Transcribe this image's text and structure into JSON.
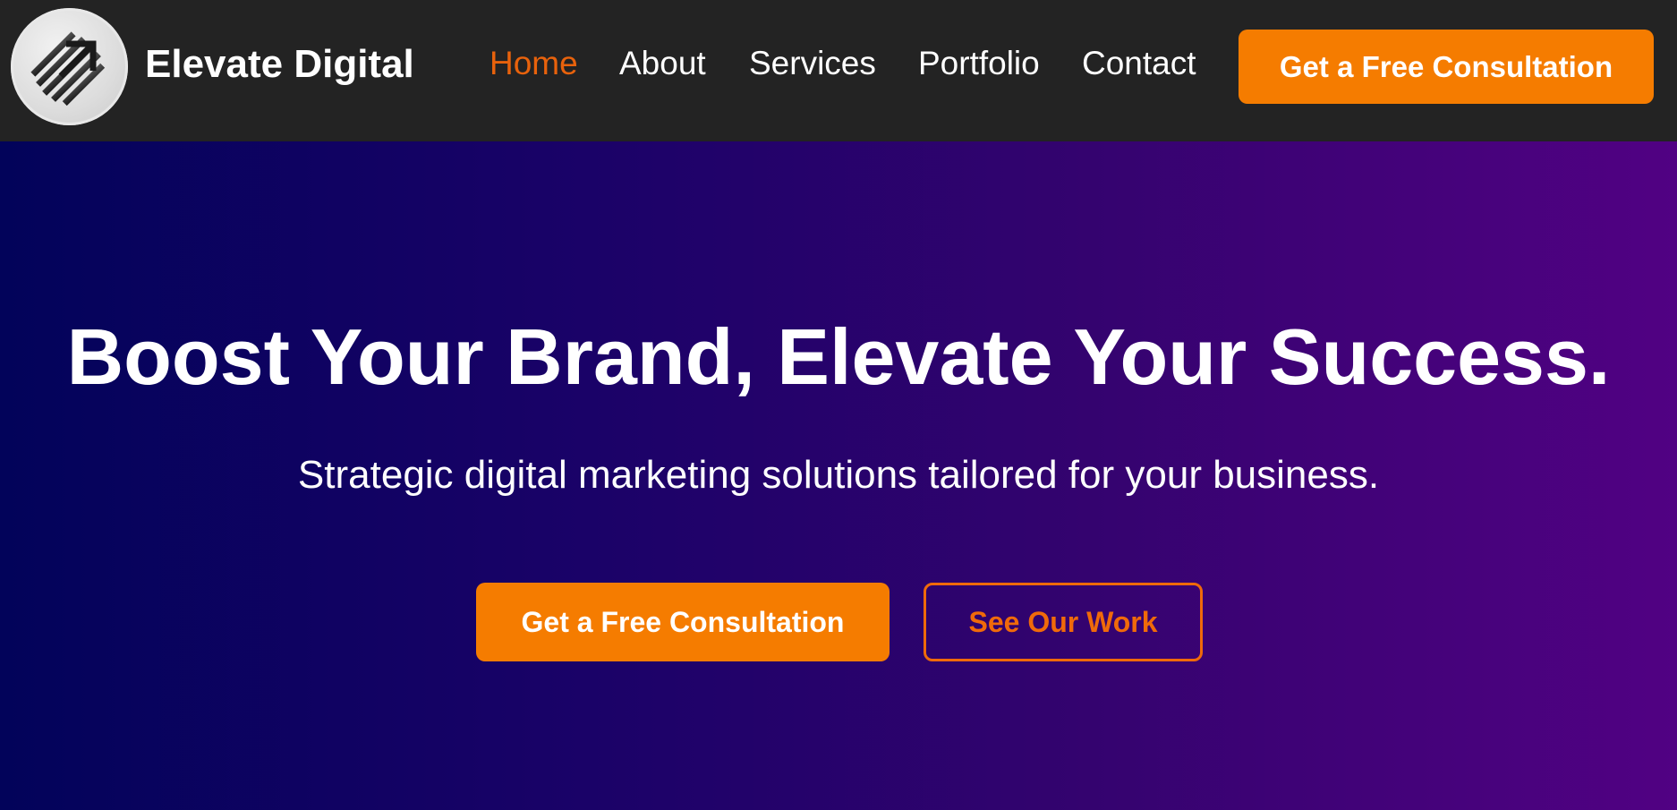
{
  "header": {
    "brand_name": "Elevate Digital",
    "logo_icon": "rising-arrow-stripes-icon",
    "nav": [
      {
        "label": "Home",
        "active": true
      },
      {
        "label": "About",
        "active": false
      },
      {
        "label": "Services",
        "active": false
      },
      {
        "label": "Portfolio",
        "active": false
      },
      {
        "label": "Contact",
        "active": false
      }
    ],
    "cta_label": "Get a Free Consultation"
  },
  "hero": {
    "title": "Boost Your Brand, Elevate Your Success.",
    "subtitle": "Strategic digital marketing solutions tailored for your business.",
    "primary_button": "Get a Free Consultation",
    "secondary_button": "See Our Work"
  },
  "colors": {
    "header_bg": "#232323",
    "accent_orange": "#f57c00",
    "active_nav": "#e8620c",
    "hero_gradient_start": "#02035a",
    "hero_gradient_end": "#510183"
  }
}
